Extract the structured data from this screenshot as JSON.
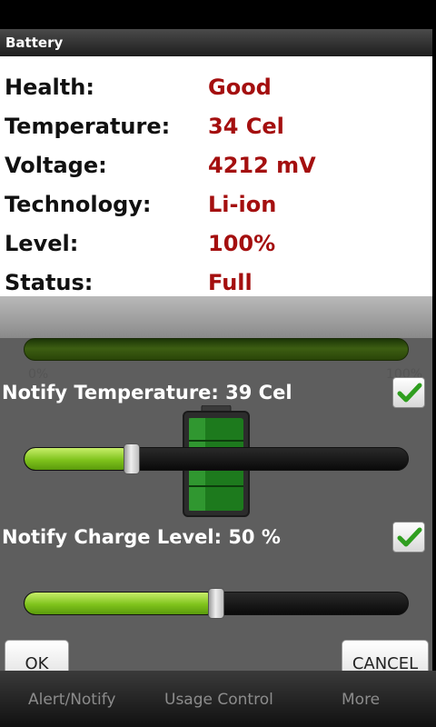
{
  "dialog": {
    "title": "Battery"
  },
  "info": [
    {
      "label": "Health:",
      "value": "Good"
    },
    {
      "label": "Temperature:",
      "value": "34 Cel"
    },
    {
      "label": "Voltage:",
      "value": "4212 mV"
    },
    {
      "label": "Technology:",
      "value": "Li-ion"
    },
    {
      "label": "Level:",
      "value": "100%"
    },
    {
      "label": "Status:",
      "value": "Full"
    }
  ],
  "level_bar": {
    "min_label": "0%",
    "max_label": "100%",
    "fraction": 1.0
  },
  "notify_temperature": {
    "label": "Notify Temperature:  39 Cel",
    "checked": true,
    "slider_fraction": 0.28
  },
  "notify_charge": {
    "label": "Notify Charge Level:  50 %",
    "checked": true,
    "slider_fraction": 0.5
  },
  "buttons": {
    "ok": "OK",
    "cancel": "CANCEL"
  },
  "tabs": [
    "Alert/Notify",
    "Usage Control",
    "More"
  ],
  "colors": {
    "value_text": "#a40f0f",
    "slider_fill": "#7fc31c",
    "check_mark": "#2f9e1f"
  }
}
